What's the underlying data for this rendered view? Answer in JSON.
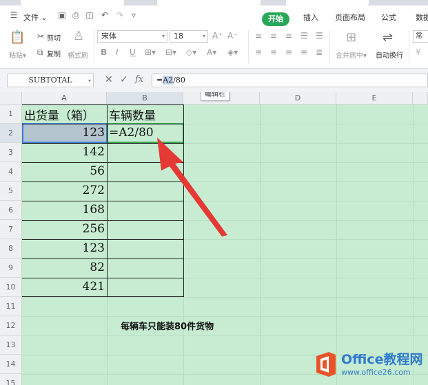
{
  "menubar": {
    "file_menu": "文件",
    "tabs": [
      {
        "label": "开始",
        "active": true
      },
      {
        "label": "插入"
      },
      {
        "label": "页面布局"
      },
      {
        "label": "公式"
      },
      {
        "label": "数据"
      }
    ]
  },
  "ribbon": {
    "cut": "剪切",
    "copy": "复制",
    "paste": "粘贴",
    "format_painter": "格式刷",
    "font_name": "宋体",
    "font_size": "18",
    "merge_center": "合并居中",
    "wrap_text": "自动换行",
    "number_format": "常"
  },
  "formula_bar": {
    "name_box": "SUBTOTAL",
    "fx_label": "fx",
    "formula_prefix": "=",
    "formula_ref": "A2",
    "formula_suffix": "/80",
    "tooltip": "编辑栏"
  },
  "sheet": {
    "columns": [
      "A",
      "B",
      "C",
      "D",
      "E"
    ],
    "rows": [
      "1",
      "2",
      "3",
      "4",
      "5",
      "6",
      "7",
      "8",
      "9",
      "10",
      "11",
      "12",
      "13",
      "14",
      "15"
    ],
    "a1": "出货量（箱）",
    "b1": "车辆数量",
    "b2_prefix": "=",
    "b2_ref": "A2",
    "b2_suffix": "/80",
    "values": [
      "123",
      "142",
      "56",
      "272",
      "168",
      "256",
      "123",
      "82",
      "421"
    ],
    "note": "每辆车只能装80件货物"
  },
  "watermark": {
    "title": "Office教程网",
    "url": "www.office26.com"
  },
  "colors": {
    "accent": "#2aa85a",
    "sheet_bg": "#c7ecd1",
    "arrow": "#e53935",
    "watermark": "#2f7bd0"
  }
}
